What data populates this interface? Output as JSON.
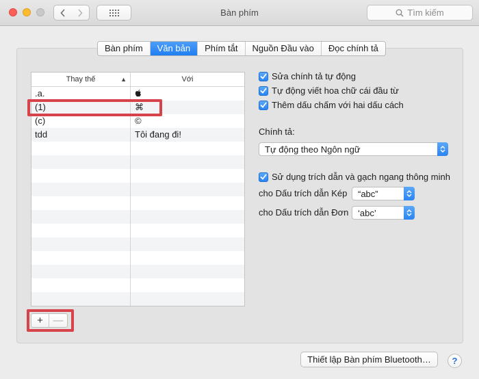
{
  "window": {
    "title": "Bàn phím"
  },
  "search": {
    "placeholder": "Tìm kiếm"
  },
  "tabs": [
    {
      "label": "Bàn phím",
      "active": false
    },
    {
      "label": "Văn bản",
      "active": true
    },
    {
      "label": "Phím tắt",
      "active": false
    },
    {
      "label": "Nguồn Đầu vào",
      "active": false
    },
    {
      "label": "Đọc chính tả",
      "active": false
    }
  ],
  "table": {
    "columns": [
      "Thay thế",
      "Với"
    ],
    "rows": [
      {
        "replace": ".a.",
        "with": ""
      },
      {
        "replace": "(1)",
        "with": "⌘"
      },
      {
        "replace": "(c)",
        "with": "©"
      },
      {
        "replace": "tdd",
        "with": "Tôi đang đi!"
      }
    ]
  },
  "options": {
    "autocorrect": {
      "label": "Sửa chính tả tự động",
      "checked": true
    },
    "capitalize": {
      "label": "Tự động viết hoa chữ cái đầu từ",
      "checked": true
    },
    "period": {
      "label": "Thêm dấu chấm với hai dấu cách",
      "checked": true
    },
    "spelling_label": "Chính tả:",
    "spelling_value": "Tự động theo Ngôn ngữ",
    "smart_quotes": {
      "label": "Sử dụng trích dẫn và gạch ngang thông minh",
      "checked": true
    },
    "double_label": "cho Dấu trích dẫn Kép",
    "double_value": "“abc”",
    "single_label": "cho Dấu trích dẫn Đơn",
    "single_value": "‘abc’"
  },
  "buttons": {
    "add": "+",
    "remove": "—",
    "bluetooth": "Thiết lập Bàn phím Bluetooth…",
    "help": "?"
  },
  "colors": {
    "accent": "#2a84f1",
    "highlight": "#d6434b"
  }
}
